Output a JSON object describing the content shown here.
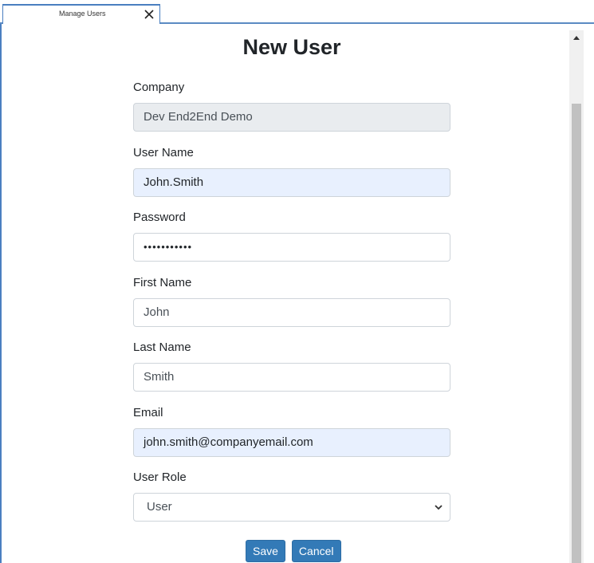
{
  "tab": {
    "label": "Manage Users"
  },
  "page": {
    "title": "New User"
  },
  "form": {
    "company": {
      "label": "Company",
      "value": "Dev End2End Demo"
    },
    "username": {
      "label": "User Name",
      "value": "John.Smith"
    },
    "password": {
      "label": "Password",
      "value": "•••••••••••"
    },
    "first_name": {
      "label": "First Name",
      "value": "John"
    },
    "last_name": {
      "label": "Last Name",
      "value": "Smith"
    },
    "email": {
      "label": "Email",
      "value": "john.smith@companyemail.com"
    },
    "user_role": {
      "label": "User Role",
      "selected": "User"
    }
  },
  "buttons": {
    "save": "Save",
    "cancel": "Cancel"
  },
  "colors": {
    "accent": "#337ab7",
    "tab_border": "#4a7fc0",
    "autofill": "#e8f0fe",
    "disabled": "#e9ecef"
  }
}
